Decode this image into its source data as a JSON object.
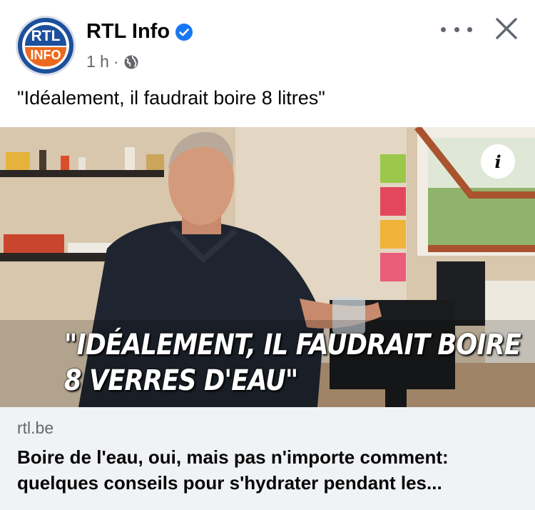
{
  "post": {
    "author": "RTL Info",
    "verified": true,
    "time": "1 h",
    "separator": "·",
    "audience_icon": "globe-icon",
    "avatar_top": "RTL",
    "avatar_bottom": "INFO",
    "text": "\"Idéalement, il faudrait boire 8 litres\""
  },
  "header_actions": {
    "more_icon": "more-dots-icon",
    "close_icon": "close-icon"
  },
  "media": {
    "info_icon_label": "i",
    "caption_line1": "\"IDÉALEMENT, IL FAUDRAIT BOIRE",
    "caption_line2": "8 VERRES D'EAU\""
  },
  "link": {
    "domain": "rtl.be",
    "title": "Boire de l'eau, oui, mais pas n'importe comment: quelques conseils pour s'hydrater pendant les..."
  },
  "colors": {
    "verified_blue": "#1877f2",
    "brand_blue": "#1c4f9c",
    "brand_orange": "#ec6a1f",
    "secondary_text": "#65676b",
    "card_bg": "#f0f2f5"
  }
}
